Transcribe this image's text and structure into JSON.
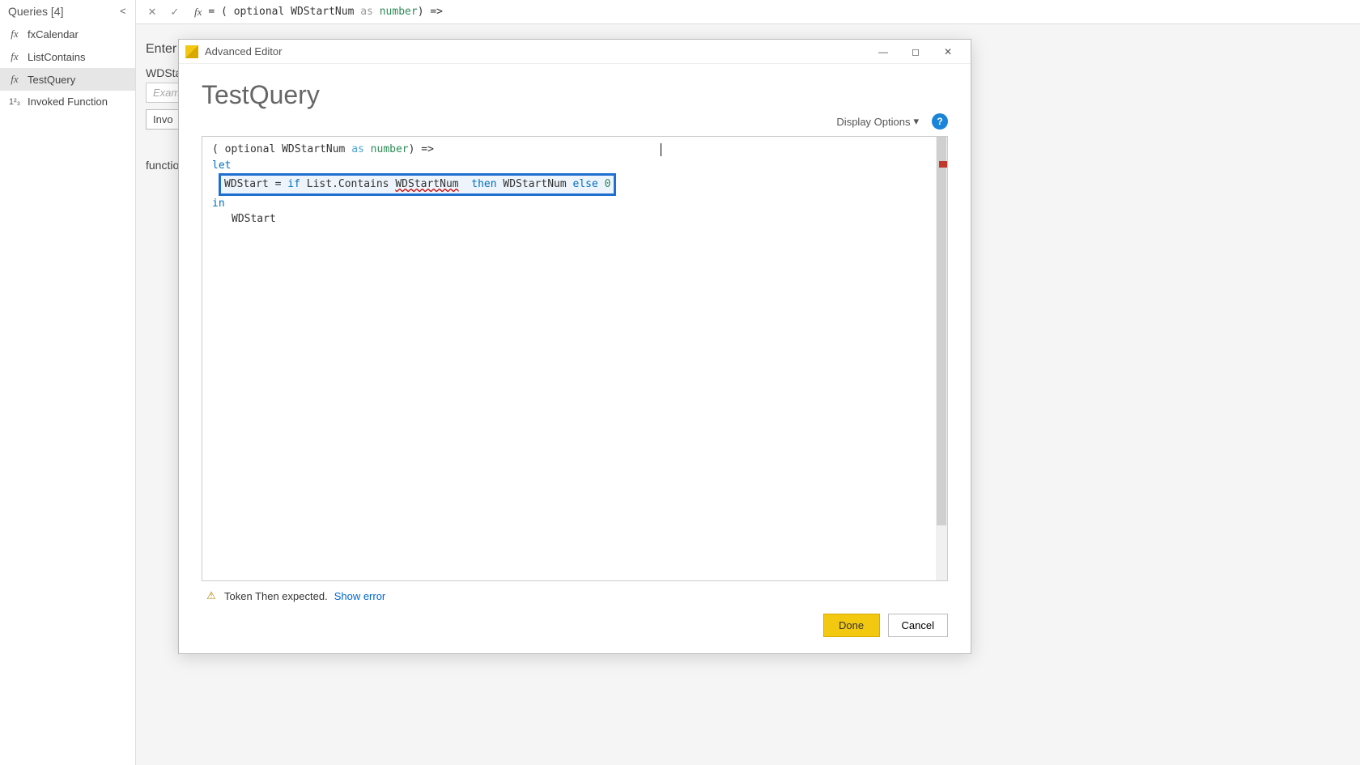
{
  "queries_panel": {
    "header": "Queries [4]",
    "items": [
      {
        "icon": "fx",
        "label": "fxCalendar"
      },
      {
        "icon": "fx",
        "label": "ListContains"
      },
      {
        "icon": "fx",
        "label": "TestQuery"
      },
      {
        "icon": "1²₃",
        "label": "Invoked Function"
      }
    ]
  },
  "formula_bar": {
    "prefix": "= ( optional WDStartNum ",
    "kw_as": "as",
    "kw_type": " number",
    "suffix": ") =>"
  },
  "background": {
    "enter_label": "Enter",
    "field_label": "WDSta",
    "placeholder1": "Exam",
    "button1": "Invo",
    "function_label": "function"
  },
  "dialog": {
    "title": "Advanced Editor",
    "query_name": "TestQuery",
    "display_options": "Display Options",
    "code": {
      "line1_pre": "( optional WDStartNum ",
      "line1_as": "as",
      "line1_type": " number",
      "line1_post": ") =>",
      "line2": "let",
      "line3_pre": "WDStart = ",
      "line3_if": "if",
      "line3_mid1": " List.Contains ",
      "line3_err": "WDStartNum",
      "line3_sp": "  ",
      "line3_then": "then",
      "line3_mid2": " WDStartNum ",
      "line3_else": "else",
      "line3_zero": " 0",
      "line4": "in",
      "line5": "WDStart"
    },
    "error_text": "Token Then expected.",
    "show_error": "Show error",
    "done": "Done",
    "cancel": "Cancel"
  }
}
